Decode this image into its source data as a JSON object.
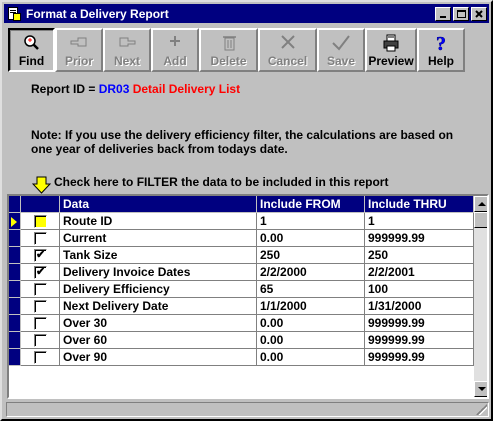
{
  "window": {
    "title": "Format a Delivery Report"
  },
  "toolbar": {
    "buttons": [
      {
        "label": "Find",
        "icon": "magnifier-icon",
        "enabled": true
      },
      {
        "label": "Prior",
        "icon": "hand-left-icon",
        "enabled": false
      },
      {
        "label": "Next",
        "icon": "hand-right-icon",
        "enabled": false
      },
      {
        "label": "Add",
        "icon": "plus-icon",
        "enabled": false
      },
      {
        "label": "Delete",
        "icon": "trash-icon",
        "enabled": false
      },
      {
        "label": "Cancel",
        "icon": "x-icon",
        "enabled": false
      },
      {
        "label": "Save",
        "icon": "checkmark-icon",
        "enabled": false
      },
      {
        "label": "Preview",
        "icon": "printer-icon",
        "enabled": true
      },
      {
        "label": "Help",
        "icon": "question-icon",
        "enabled": true
      }
    ]
  },
  "report": {
    "id_label": "Report ID =",
    "id_value": "DR03",
    "name": "Detail Delivery List"
  },
  "note": "Note: If you use the delivery efficiency filter, the calculations are based on one year of deliveries back from todays date.",
  "filter_hint": "Check here to FILTER the data to be included in this report",
  "grid": {
    "headers": {
      "data": "Data",
      "from": "Include FROM",
      "thru": "Include THRU"
    },
    "rows": [
      {
        "checked": false,
        "data": "Route ID",
        "from": "1",
        "thru": "1"
      },
      {
        "checked": false,
        "data": "Current",
        "from": "0.00",
        "thru": "999999.99"
      },
      {
        "checked": true,
        "data": "Tank Size",
        "from": "250",
        "thru": "250"
      },
      {
        "checked": true,
        "data": "Delivery Invoice Dates",
        "from": "2/2/2000",
        "thru": "2/2/2001"
      },
      {
        "checked": false,
        "data": "Delivery Efficiency",
        "from": "65",
        "thru": "100"
      },
      {
        "checked": false,
        "data": "Next Delivery Date",
        "from": "1/1/2000",
        "thru": "1/31/2000"
      },
      {
        "checked": false,
        "data": "Over 30",
        "from": "0.00",
        "thru": "999999.99"
      },
      {
        "checked": false,
        "data": "Over 60",
        "from": "0.00",
        "thru": "999999.99"
      },
      {
        "checked": false,
        "data": "Over 90",
        "from": "0.00",
        "thru": "999999.99"
      }
    ],
    "current_row": 0
  },
  "colors": {
    "titlebar": "#000080",
    "report_id": "#0000ff",
    "report_name": "#ff0000",
    "highlight": "#ffff00"
  }
}
